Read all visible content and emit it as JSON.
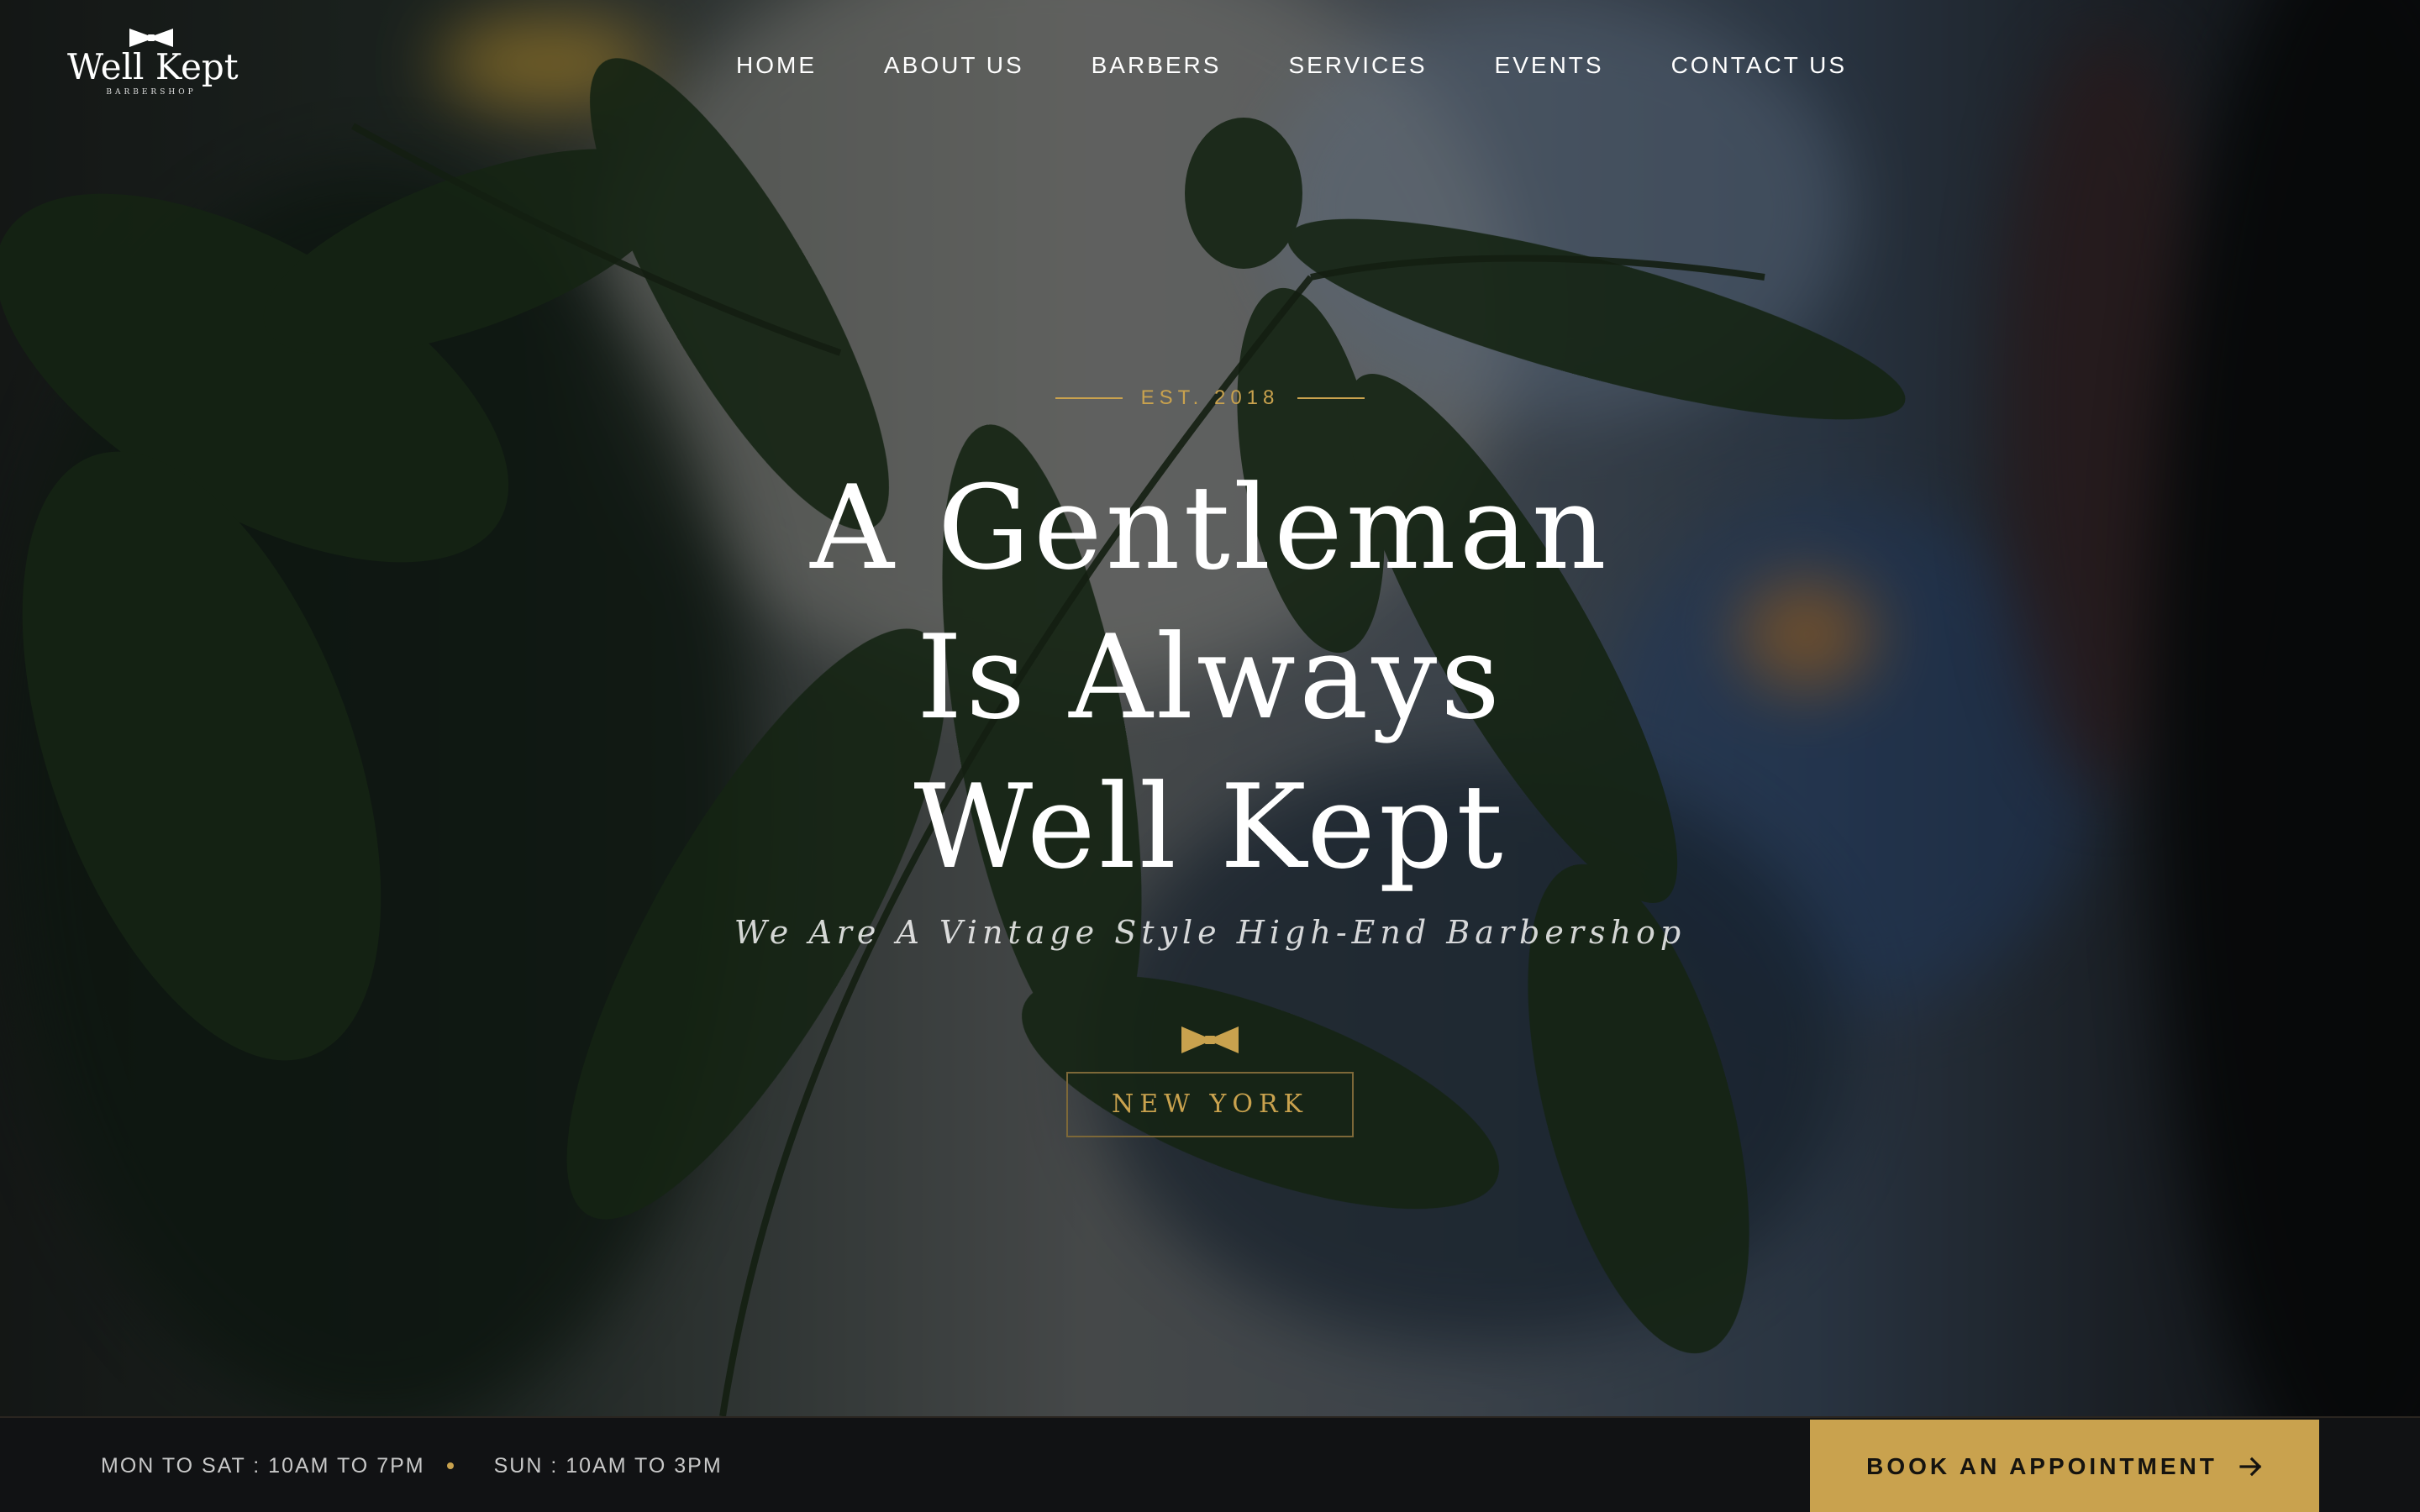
{
  "brand": {
    "name": "Well Kept",
    "subtitle": "BARBERSHOP"
  },
  "nav": {
    "items": [
      "HOME",
      "ABOUT US",
      "BARBERS",
      "SERVICES",
      "EVENTS",
      "CONTACT US"
    ]
  },
  "hero": {
    "established": "EST. 2018",
    "headline": [
      "A Gentleman",
      "Is Always",
      "Well Kept"
    ],
    "tagline": "We Are A Vintage Style High-End Barbershop",
    "location": "NEW YORK"
  },
  "footer_bar": {
    "hours_weekdays": "MON TO SAT : 10AM TO 7PM",
    "hours_sunday": "SUN : 10AM TO 3PM",
    "cta_label": "BOOK AN APPOINTMENT"
  },
  "icons": {
    "logo_bow": "bow-tie-icon",
    "hero_bow": "bow-tie-icon",
    "cta_arrow": "arrow-right-icon"
  },
  "colors": {
    "accent_gold": "#c9a24e",
    "bar_background": "#111214",
    "text_white": "#ffffff"
  }
}
